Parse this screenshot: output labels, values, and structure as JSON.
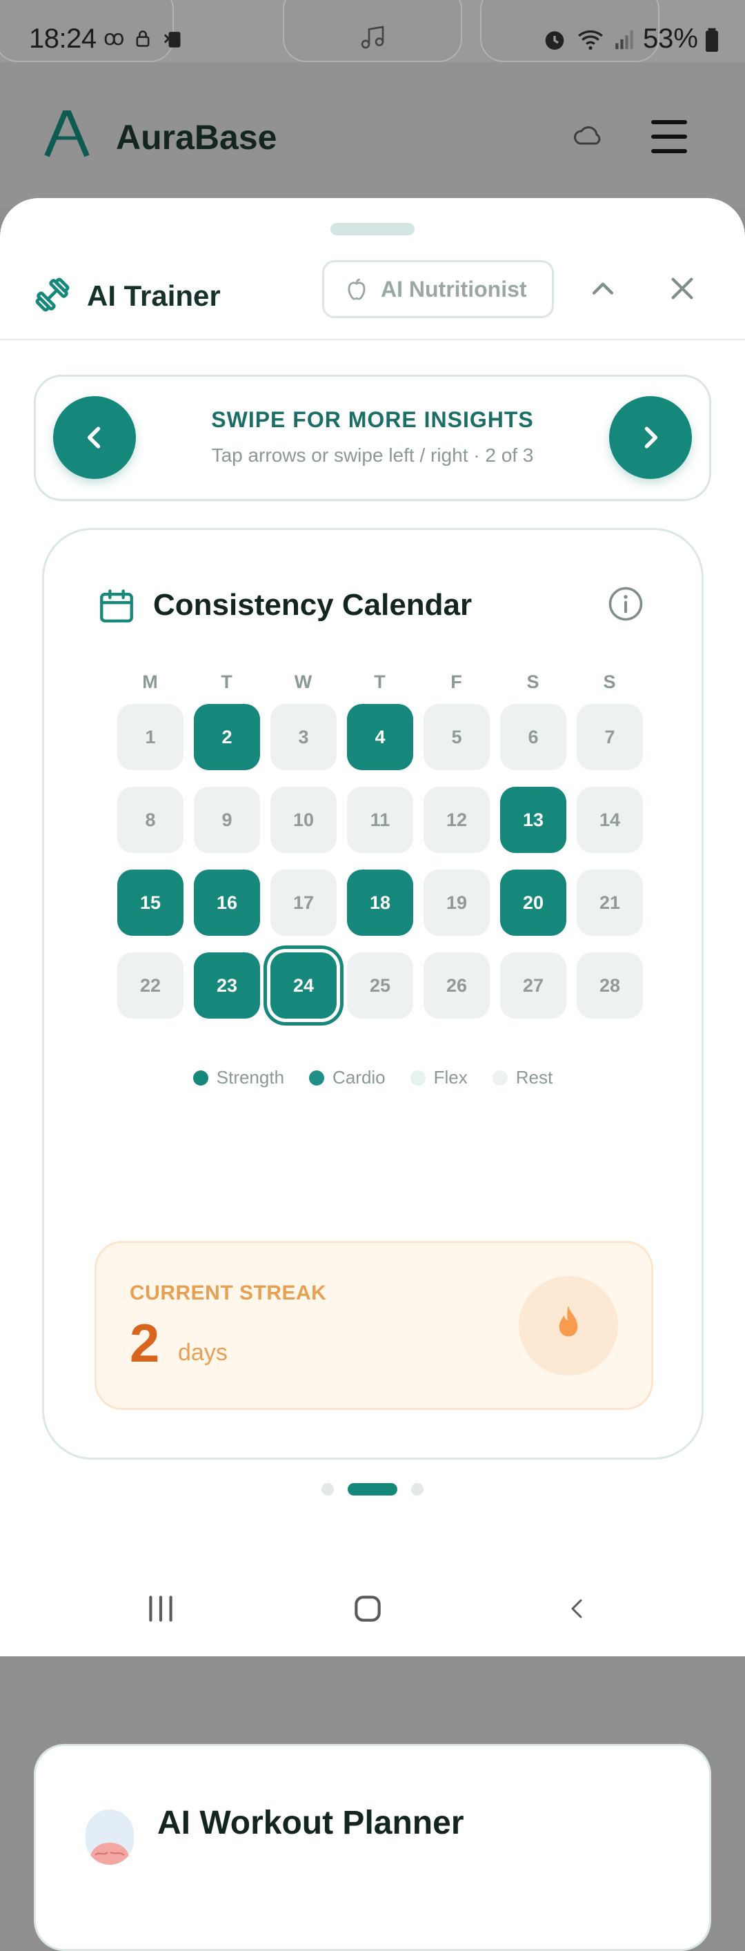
{
  "status_bar": {
    "time": "18:24",
    "battery_pct": "53%"
  },
  "app": {
    "brand_name": "AuraBase"
  },
  "sheet": {
    "title": "AI Trainer",
    "nutritionist_label": "AI Nutritionist"
  },
  "swipe": {
    "title": "SWIPE FOR MORE INSIGHTS",
    "subtitle": "Tap arrows or swipe left / right · 2 of 3"
  },
  "calendar": {
    "title": "Consistency Calendar",
    "weekdays": [
      "M",
      "T",
      "W",
      "T",
      "F",
      "S",
      "S"
    ],
    "days": [
      {
        "label": "1",
        "state": "rest"
      },
      {
        "label": "2",
        "state": "active"
      },
      {
        "label": "3",
        "state": "rest"
      },
      {
        "label": "4",
        "state": "active"
      },
      {
        "label": "5",
        "state": "rest"
      },
      {
        "label": "6",
        "state": "rest"
      },
      {
        "label": "7",
        "state": "rest"
      },
      {
        "label": "8",
        "state": "rest"
      },
      {
        "label": "9",
        "state": "rest"
      },
      {
        "label": "10",
        "state": "rest"
      },
      {
        "label": "11",
        "state": "rest"
      },
      {
        "label": "12",
        "state": "rest"
      },
      {
        "label": "13",
        "state": "active"
      },
      {
        "label": "14",
        "state": "rest"
      },
      {
        "label": "15",
        "state": "active"
      },
      {
        "label": "16",
        "state": "active"
      },
      {
        "label": "17",
        "state": "rest"
      },
      {
        "label": "18",
        "state": "active"
      },
      {
        "label": "19",
        "state": "rest"
      },
      {
        "label": "20",
        "state": "active"
      },
      {
        "label": "21",
        "state": "rest"
      },
      {
        "label": "22",
        "state": "rest"
      },
      {
        "label": "23",
        "state": "active"
      },
      {
        "label": "24",
        "state": "today"
      },
      {
        "label": "25",
        "state": "rest"
      },
      {
        "label": "26",
        "state": "rest"
      },
      {
        "label": "27",
        "state": "rest"
      },
      {
        "label": "28",
        "state": "rest"
      }
    ],
    "legend": [
      {
        "label": "Strength",
        "color": "#16877b"
      },
      {
        "label": "Cardio",
        "color": "#1f8f86"
      },
      {
        "label": "Flex",
        "color": "#e6f2f0"
      },
      {
        "label": "Rest",
        "color": "#eef1f1"
      }
    ]
  },
  "streak": {
    "label": "CURRENT STREAK",
    "value": "2",
    "unit": "days"
  },
  "pager": {
    "count": 3,
    "active_index": 1
  },
  "next_card": {
    "title": "AI Workout Planner"
  },
  "colors": {
    "accent": "#16877b",
    "streak_orange": "#d9641e"
  }
}
